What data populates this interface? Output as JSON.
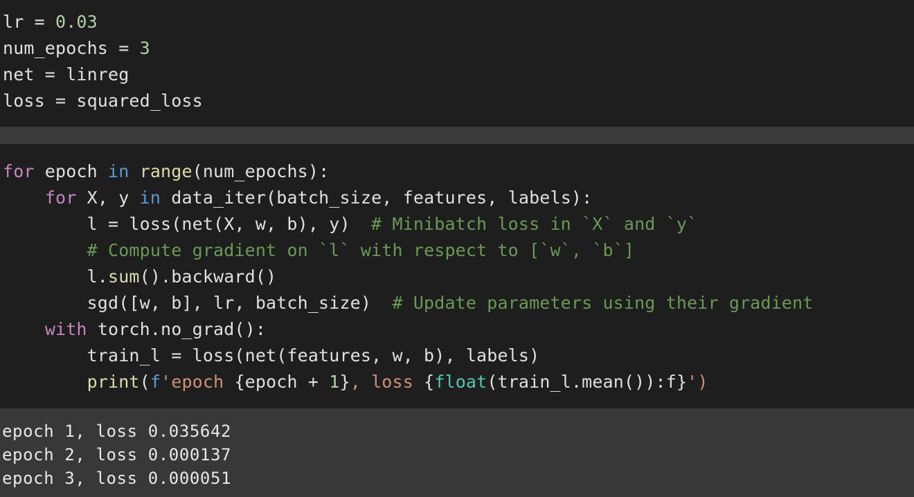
{
  "cell_1": {
    "lines": [
      [
        {
          "t": "lr = ",
          "c": "op"
        },
        {
          "t": "0.03",
          "c": "num"
        }
      ],
      [
        {
          "t": "num_epochs = ",
          "c": "op"
        },
        {
          "t": "3",
          "c": "num"
        }
      ],
      [
        {
          "t": "net = linreg",
          "c": "op"
        }
      ],
      [
        {
          "t": "loss = squared_loss",
          "c": "op"
        }
      ]
    ]
  },
  "cell_2": {
    "lines": [
      [
        {
          "t": "for",
          "c": "kw"
        },
        {
          "t": " epoch ",
          "c": "op"
        },
        {
          "t": "in",
          "c": "inkw"
        },
        {
          "t": " ",
          "c": "op"
        },
        {
          "t": "range",
          "c": "bi"
        },
        {
          "t": "(num_epochs):",
          "c": "op"
        }
      ],
      [
        {
          "t": "    ",
          "c": "op"
        },
        {
          "t": "for",
          "c": "kw"
        },
        {
          "t": " X, y ",
          "c": "op"
        },
        {
          "t": "in",
          "c": "inkw"
        },
        {
          "t": " data_iter(batch_size, features, labels):",
          "c": "op"
        }
      ],
      [
        {
          "t": "        l = loss(net(X, w, b), y)  ",
          "c": "op"
        },
        {
          "t": "# Minibatch loss in `X` and `y`",
          "c": "cm"
        }
      ],
      [
        {
          "t": "        ",
          "c": "op"
        },
        {
          "t": "# Compute gradient on `l` with respect to [`w`, `b`]",
          "c": "cm"
        }
      ],
      [
        {
          "t": "        l.",
          "c": "op"
        },
        {
          "t": "sum",
          "c": "bi"
        },
        {
          "t": "().backward()",
          "c": "op"
        }
      ],
      [
        {
          "t": "        sgd([w, b], lr, batch_size)  ",
          "c": "op"
        },
        {
          "t": "# Update parameters using their gradient",
          "c": "cm"
        }
      ],
      [
        {
          "t": "    ",
          "c": "op"
        },
        {
          "t": "with",
          "c": "kw"
        },
        {
          "t": " torch.no_grad():",
          "c": "op"
        }
      ],
      [
        {
          "t": "        train_l = loss(net(features, w, b), labels)",
          "c": "op"
        }
      ],
      [
        {
          "t": "        ",
          "c": "op"
        },
        {
          "t": "print",
          "c": "bi"
        },
        {
          "t": "(",
          "c": "op"
        },
        {
          "t": "f",
          "c": "fpre"
        },
        {
          "t": "'epoch ",
          "c": "str"
        },
        {
          "t": "{epoch + ",
          "c": "op"
        },
        {
          "t": "1",
          "c": "num"
        },
        {
          "t": "}",
          "c": "op"
        },
        {
          "t": ", loss ",
          "c": "str"
        },
        {
          "t": "{",
          "c": "op"
        },
        {
          "t": "float",
          "c": "bfn"
        },
        {
          "t": "(train_l.mean()):f}",
          "c": "op"
        },
        {
          "t": "')",
          "c": "str"
        }
      ]
    ]
  },
  "output": {
    "lines": [
      "epoch 1, loss 0.035642",
      "epoch 2, loss 0.000137",
      "epoch 3, loss 0.000051"
    ]
  }
}
